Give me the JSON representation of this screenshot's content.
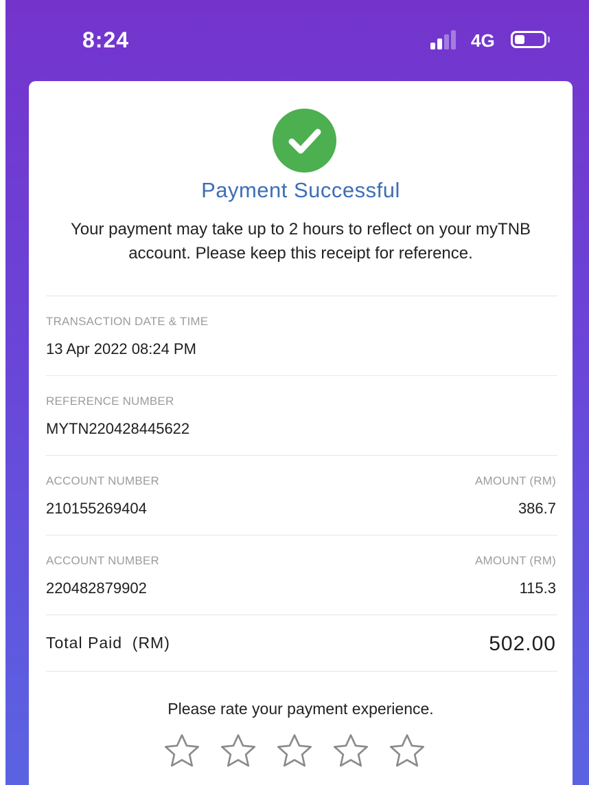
{
  "status_bar": {
    "time": "8:24",
    "network": "4G",
    "signal_icon": "cellular-signal-icon",
    "battery_icon": "battery-icon",
    "signal_bars_active": 2,
    "signal_bars_total": 4,
    "battery_level": 0.35
  },
  "receipt": {
    "status_icon": "check-circle-icon",
    "title": "Payment Successful",
    "message": "Your payment may take up to 2 hours to reflect on your myTNB account. Please keep this receipt for reference.",
    "transaction_date_label": "TRANSACTION DATE & TIME",
    "transaction_date_value": "13 Apr 2022 08:24 PM",
    "reference_label": "REFERENCE NUMBER",
    "reference_value": "MYTN220428445622",
    "accounts": [
      {
        "account_label": "ACCOUNT NUMBER",
        "account_number": "210155269404",
        "amount_label": "AMOUNT (RM)",
        "amount": "386.7"
      },
      {
        "account_label": "ACCOUNT NUMBER",
        "account_number": "220482879902",
        "amount_label": "AMOUNT (RM)",
        "amount": "115.3"
      }
    ],
    "total_label": "Total Paid  (RM)",
    "total_value": "502.00"
  },
  "rating": {
    "prompt": "Please rate your payment experience.",
    "star_icon": "star-outline-icon",
    "max_stars": 5,
    "selected_stars": 0
  },
  "colors": {
    "background_top": "#7434cc",
    "background_bottom": "#5a63e2",
    "success_green": "#4caf50",
    "title_blue": "#3c6fb6",
    "label_gray": "#9c9c9c",
    "star_outline": "#8a8a8a"
  }
}
